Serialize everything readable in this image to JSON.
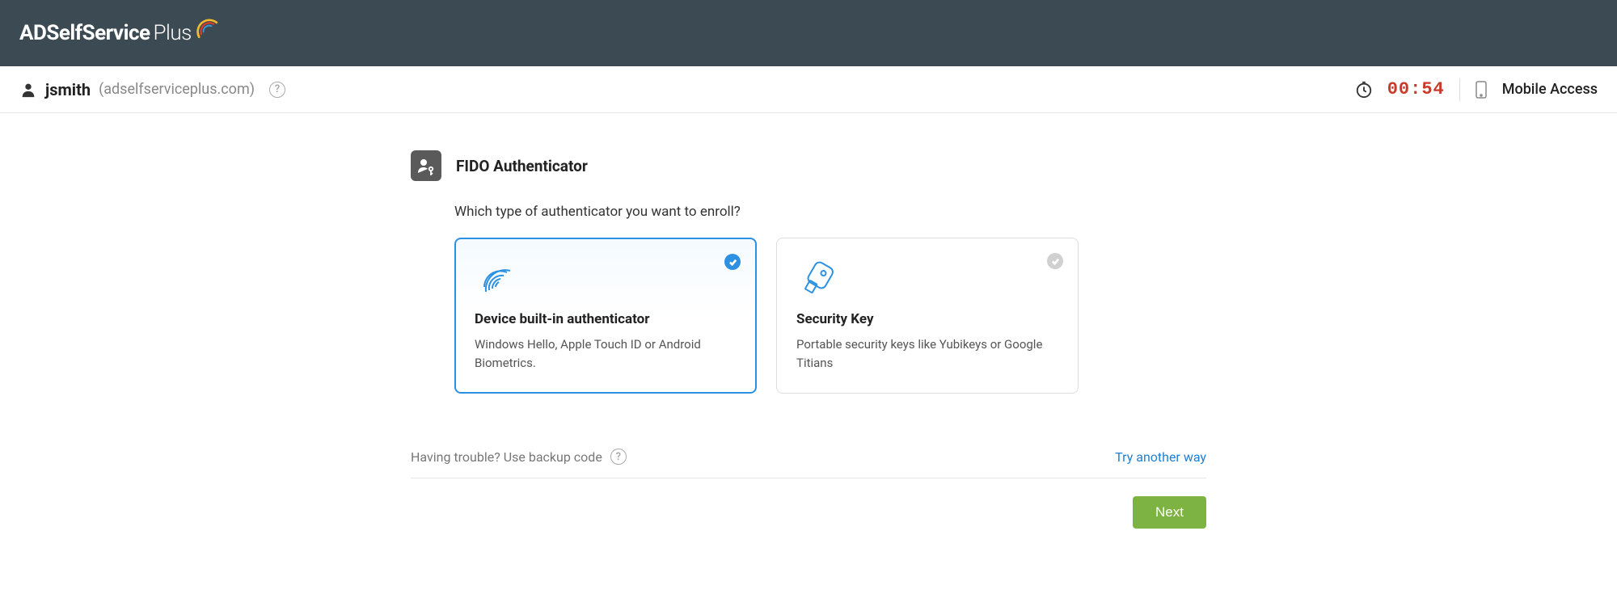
{
  "header": {
    "brand_bold": "ADSelfService",
    "brand_light": "Plus"
  },
  "userbar": {
    "username": "jsmith",
    "domain": "(adselfserviceplus.com)",
    "timer": "00:54",
    "mobile_access": "Mobile Access"
  },
  "main": {
    "title": "FIDO Authenticator",
    "prompt": "Which type of authenticator you want to enroll?",
    "cards": [
      {
        "title": "Device built-in authenticator",
        "desc": "Windows Hello, Apple Touch ID or Android Biometrics.",
        "selected": true,
        "icon": "fingerprint"
      },
      {
        "title": "Security Key",
        "desc": "Portable security keys like Yubikeys or Google Titians",
        "selected": false,
        "icon": "usb-key"
      }
    ],
    "trouble_text": "Having trouble? Use backup code",
    "try_another": "Try another way",
    "next_label": "Next"
  }
}
